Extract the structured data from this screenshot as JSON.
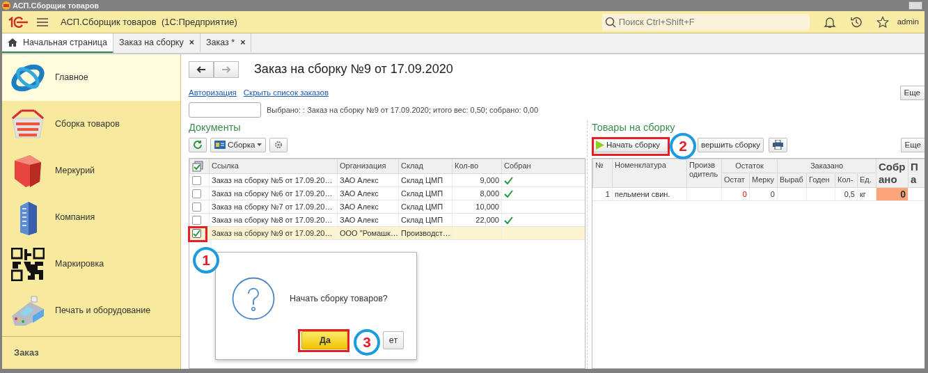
{
  "window": {
    "title": "АСП.Сборщик товаров"
  },
  "app_bar": {
    "title": "АСП.Сборщик товаров  (1С:Предприятие)",
    "search": {
      "placeholder": "Поиск Ctrl+Shift+F"
    },
    "user": "admin"
  },
  "tabs": [
    {
      "label": "Начальная страница",
      "kind": "home",
      "selected": true
    },
    {
      "label": "Заказ на сборку",
      "kind": "document",
      "close": "×",
      "selected": false
    },
    {
      "label": "Заказ *",
      "kind": "document",
      "close": "×",
      "selected": false
    }
  ],
  "sidebar": {
    "items": [
      {
        "label": "Главное",
        "selected": true
      },
      {
        "label": "Сборка товаров",
        "selected": false
      },
      {
        "label": "Меркурий",
        "selected": false
      },
      {
        "label": "Компания",
        "selected": false
      },
      {
        "label": "Маркировка",
        "selected": false
      },
      {
        "label": "Печать и оборудование",
        "selected": false
      }
    ],
    "footer": "Заказ"
  },
  "form": {
    "title": "Заказ на сборку №9 от 17.09.2020",
    "links": [
      "Авторизация",
      "Скрыть список заказов"
    ],
    "more_button": "Еще",
    "summary": "Выбрано: : Заказ на сборку №9 от 17.09.2020; итого вес: 0,50; собрано: 0,00",
    "documents": {
      "title": "Документы",
      "dropdown": "Сборка",
      "columns": [
        "Ссылка",
        "Организация",
        "Склад",
        "Кол-во",
        "Собран"
      ],
      "rows": [
        {
          "checked": false,
          "selected": false,
          "collected": true,
          "cells": [
            "Заказ на сборку №5 от 17.09.20…",
            "ЗАО Алекс",
            "Склад ЦМП",
            "9,000"
          ]
        },
        {
          "checked": false,
          "selected": false,
          "collected": true,
          "cells": [
            "Заказ на сборку №6 от 17.09.20…",
            "ЗАО Алекс",
            "Склад ЦМП",
            "8,000"
          ]
        },
        {
          "checked": false,
          "selected": false,
          "collected": false,
          "cells": [
            "Заказ на сборку №7 от 17.09.20…",
            "ЗАО Алекс",
            "Склад ЦМП",
            "10,000"
          ]
        },
        {
          "checked": false,
          "selected": false,
          "collected": true,
          "cells": [
            "Заказ на сборку №8 от 17.09.20…",
            "ЗАО Алекс",
            "Склад ЦМП",
            "22,000"
          ]
        },
        {
          "checked": true,
          "selected": true,
          "collected": false,
          "cells": [
            "Заказ на сборку №9 от 17.09.20…",
            "ООО \"Ромашк…",
            "Производст…",
            ""
          ]
        }
      ]
    },
    "goods": {
      "title": "Товары на сборку",
      "buttons": [
        "Начать сборку",
        "вершить сборку"
      ],
      "more_button": "Еще",
      "column_groups": [
        {
          "label": "Остаток"
        },
        {
          "label": "Заказано"
        }
      ],
      "columns": [
        {
          "label": "№"
        },
        {
          "label": "Номенклатура"
        },
        {
          "label": "Производитель"
        },
        {
          "label": "Остат"
        },
        {
          "label": "Мерку"
        },
        {
          "label": "Выраб"
        },
        {
          "label": "Годен"
        },
        {
          "label": "Кол-"
        },
        {
          "label": "Ед."
        },
        {
          "label": "Собрано",
          "bold": true
        },
        {
          "label": "Па",
          "bold": true
        }
      ],
      "rows": [
        {
          "cells": [
            "1",
            "пельмени свин.",
            "",
            {
              "text": "0",
              "alert": true
            },
            "0",
            "",
            "",
            "0,5",
            "кг",
            {
              "text": "0",
              "highlight": true
            },
            ""
          ]
        }
      ]
    }
  },
  "dialog": {
    "message": "Начать сборку товаров?",
    "buttons": [
      {
        "label": "Да",
        "default": true
      },
      {
        "label": "ет",
        "default": false
      }
    ]
  },
  "annotations": [
    {
      "label": "1"
    },
    {
      "label": "2"
    },
    {
      "label": "3"
    }
  ]
}
